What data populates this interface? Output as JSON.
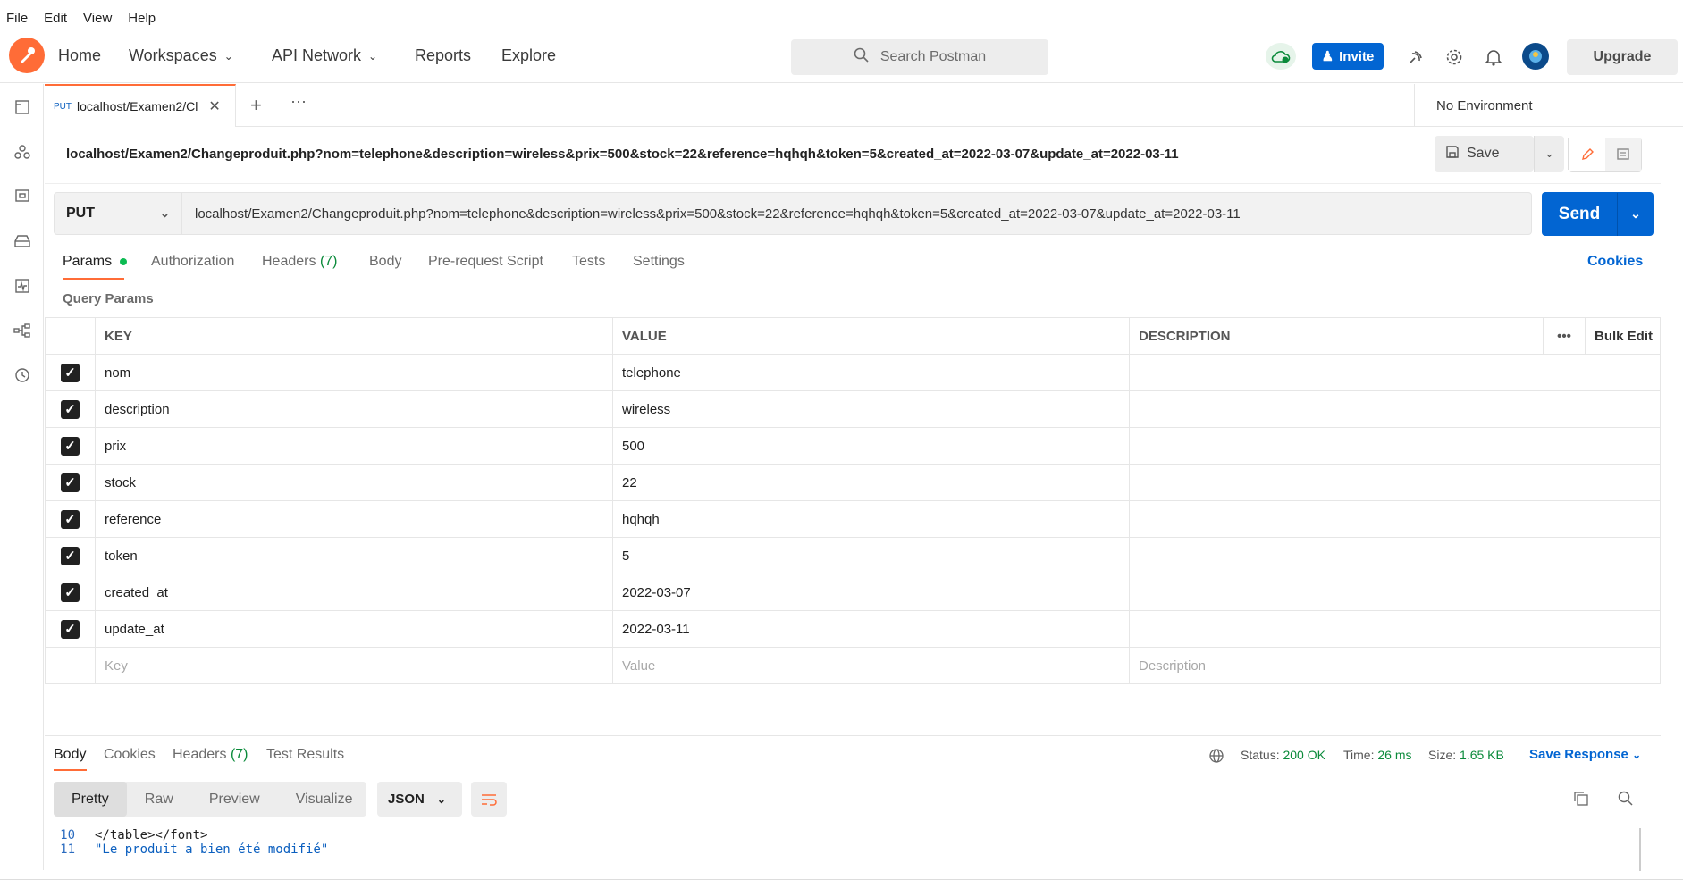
{
  "menubar": {
    "items": [
      "File",
      "Edit",
      "View",
      "Help"
    ]
  },
  "header": {
    "nav": {
      "home": "Home",
      "workspaces": "Workspaces",
      "api_network": "API Network",
      "reports": "Reports",
      "explore": "Explore"
    },
    "search_placeholder": "Search Postman",
    "invite": "Invite",
    "upgrade": "Upgrade"
  },
  "tab": {
    "method": "PUT",
    "title": "localhost/Examen2/Cl"
  },
  "environment": "No Environment",
  "request": {
    "url": "localhost/Examen2/Changeproduit.php?nom=telephone&description=wireless&prix=500&stock=22&reference=hqhqh&token=5&created_at=2022-03-07&update_at=2022-03-11",
    "method": "PUT",
    "save": "Save",
    "send": "Send"
  },
  "request_tabs": {
    "params": "Params",
    "authorization": "Authorization",
    "headers": "Headers",
    "headers_count": "(7)",
    "body": "Body",
    "prerequest": "Pre-request Script",
    "tests": "Tests",
    "settings": "Settings",
    "cookies": "Cookies"
  },
  "query_params_label": "Query Params",
  "params_table": {
    "headers": {
      "key": "KEY",
      "value": "VALUE",
      "description": "DESCRIPTION",
      "bulk_edit": "Bulk Edit"
    },
    "rows": [
      {
        "key": "nom",
        "value": "telephone"
      },
      {
        "key": "description",
        "value": "wireless"
      },
      {
        "key": "prix",
        "value": "500"
      },
      {
        "key": "stock",
        "value": "22"
      },
      {
        "key": "reference",
        "value": "hqhqh"
      },
      {
        "key": "token",
        "value": "5"
      },
      {
        "key": "created_at",
        "value": "2022-03-07"
      },
      {
        "key": "update_at",
        "value": "2022-03-11"
      }
    ],
    "placeholders": {
      "key": "Key",
      "value": "Value",
      "description": "Description"
    }
  },
  "response": {
    "tabs": {
      "body": "Body",
      "cookies": "Cookies",
      "headers": "Headers",
      "headers_count": "(7)",
      "test_results": "Test Results"
    },
    "status_label": "Status:",
    "status": "200 OK",
    "time_label": "Time:",
    "time": "26 ms",
    "size_label": "Size:",
    "size": "1.65 KB",
    "save_response": "Save Response",
    "views": {
      "pretty": "Pretty",
      "raw": "Raw",
      "preview": "Preview",
      "visualize": "Visualize"
    },
    "format": "JSON",
    "lines": [
      {
        "n": "10",
        "text": "</table></font>"
      },
      {
        "n": "11",
        "text": "\"Le produit a bien été modifié\""
      }
    ]
  },
  "colors": {
    "accent": "#ff6c37",
    "primary": "#0265d2",
    "success": "#0a8a3a"
  }
}
